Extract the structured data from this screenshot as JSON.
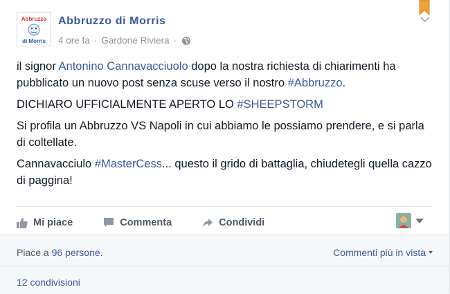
{
  "post": {
    "author": "Abbruzzo di Morris",
    "avatar_text_top": "Abbruzzo",
    "avatar_text_bottom": "di Morris",
    "time": "4 ore fa",
    "separator": "·",
    "location": "Gardone Riviera",
    "location_separator": "·",
    "privacy_icon": "globe-icon",
    "paragraph1": {
      "pre": "il signor ",
      "mention": "Antonino Cannavacciuolo",
      "mid": " dopo la nostra richiesta di chiarimenti ha pubblicato un nuovo post senza scuse verso il nostro ",
      "hashtag": "#Abbruzzo",
      "post": "."
    },
    "paragraph2": {
      "pre": "DICHIARO UFFICIALMENTE APERTO LO ",
      "hashtag": "#SHEEPSTORM"
    },
    "paragraph3": "Si profila un Abbruzzo VS Napoli in cui abbiamo le possiamo prendere, e si parla di coltellate.",
    "paragraph4": {
      "pre": "Cannavacciulo ",
      "hashtag": "#MasterCess",
      "post": "... questo il grido di battaglia, chiudetegli quella cazzo di paggina!"
    }
  },
  "actions": {
    "like": "Mi piace",
    "comment": "Commenta",
    "share": "Condividi"
  },
  "footer": {
    "likes_pre": "Piace a ",
    "likes_count": "96 persone",
    "likes_post": ".",
    "sort": "Commenti più in vista",
    "shares": "12 condivisioni"
  },
  "colors": {
    "link": "#3b5998",
    "text": "#141823",
    "muted": "#90949c",
    "bookmark": "#f0a03c"
  }
}
